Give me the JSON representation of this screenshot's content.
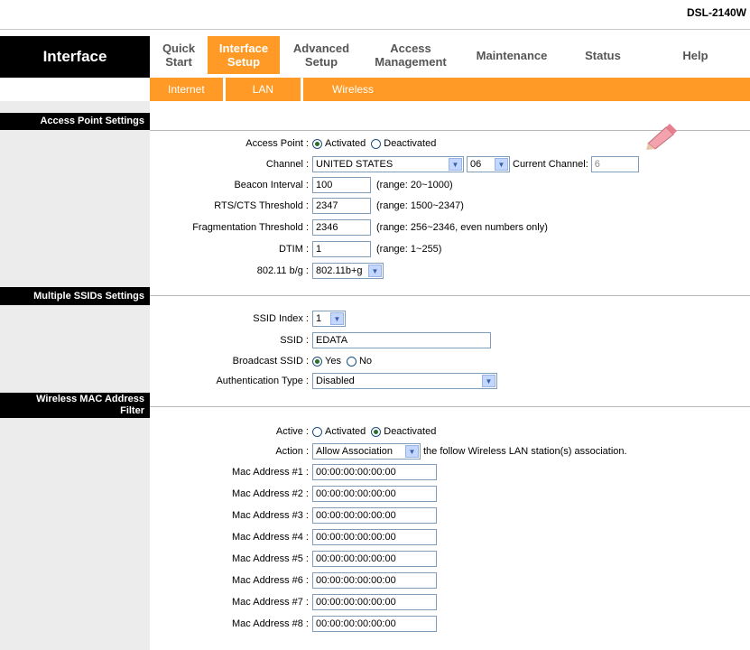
{
  "model": "DSL-2140W",
  "brand_label": "Interface",
  "nav": [
    {
      "line1": "Quick",
      "line2": "Start"
    },
    {
      "line1": "Interface",
      "line2": "Setup"
    },
    {
      "line1": "Advanced",
      "line2": "Setup"
    },
    {
      "line1": "Access",
      "line2": "Management"
    },
    {
      "line1": "Maintenance",
      "line2": ""
    },
    {
      "line1": "Status",
      "line2": ""
    },
    {
      "line1": "Help",
      "line2": ""
    }
  ],
  "subnav": [
    "Internet",
    "LAN",
    "Wireless"
  ],
  "sections": {
    "ap": "Access Point Settings",
    "ssid": "Multiple SSIDs Settings",
    "mac_line1": "Wireless MAC Address",
    "mac_line2": "Filter"
  },
  "ap": {
    "access_point_label": "Access Point :",
    "activated": "Activated",
    "deactivated": "Deactivated",
    "channel_label": "Channel :",
    "channel_country": "UNITED STATES",
    "channel_number": "06",
    "current_channel_label": "Current Channel:",
    "current_channel_value": "6",
    "beacon_label": "Beacon Interval :",
    "beacon_value": "100",
    "beacon_hint": "(range: 20~1000)",
    "rts_label": "RTS/CTS Threshold :",
    "rts_value": "2347",
    "rts_hint": "(range: 1500~2347)",
    "frag_label": "Fragmentation Threshold :",
    "frag_value": "2346",
    "frag_hint": "(range: 256~2346, even numbers only)",
    "dtim_label": "DTIM :",
    "dtim_value": "1",
    "dtim_hint": "(range: 1~255)",
    "mode_label": "802.11 b/g :",
    "mode_value": "802.11b+g"
  },
  "ssid": {
    "index_label": "SSID Index :",
    "index_value": "1",
    "ssid_label": "SSID :",
    "ssid_value": "EDATA",
    "broadcast_label": "Broadcast SSID :",
    "yes": "Yes",
    "no": "No",
    "auth_label": "Authentication Type :",
    "auth_value": "Disabled"
  },
  "mac": {
    "active_label": "Active :",
    "activated": "Activated",
    "deactivated": "Deactivated",
    "action_label": "Action :",
    "action_value": "Allow Association",
    "action_suffix": "the follow Wireless LAN station(s) association.",
    "addresses": [
      {
        "label": "Mac Address #1 :",
        "value": "00:00:00:00:00:00"
      },
      {
        "label": "Mac Address #2 :",
        "value": "00:00:00:00:00:00"
      },
      {
        "label": "Mac Address #3 :",
        "value": "00:00:00:00:00:00"
      },
      {
        "label": "Mac Address #4 :",
        "value": "00:00:00:00:00:00"
      },
      {
        "label": "Mac Address #5 :",
        "value": "00:00:00:00:00:00"
      },
      {
        "label": "Mac Address #6 :",
        "value": "00:00:00:00:00:00"
      },
      {
        "label": "Mac Address #7 :",
        "value": "00:00:00:00:00:00"
      },
      {
        "label": "Mac Address #8 :",
        "value": "00:00:00:00:00:00"
      }
    ]
  },
  "colors": {
    "accent": "#ff9a26",
    "header_black": "#000000",
    "sidebar": "#ececec"
  }
}
